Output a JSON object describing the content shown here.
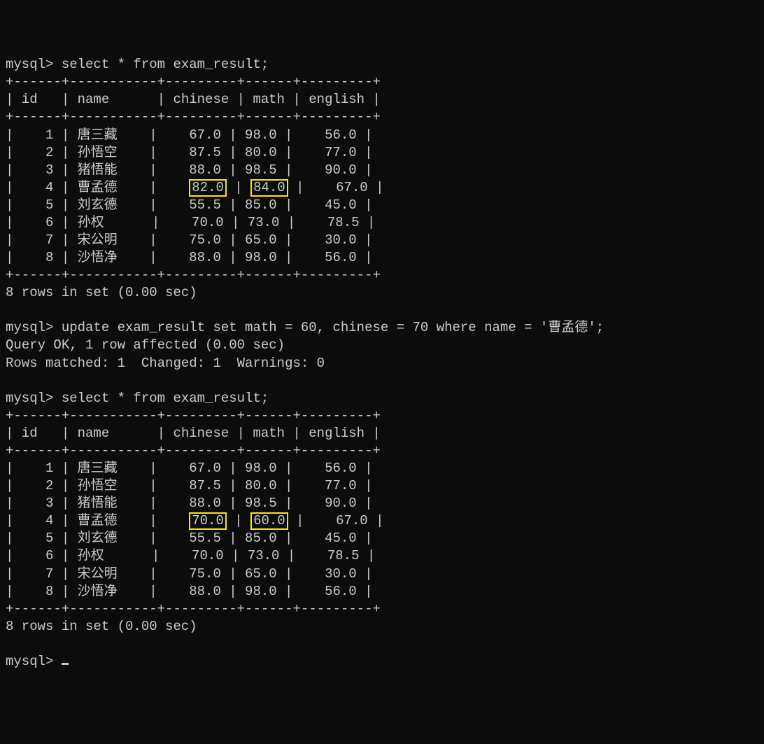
{
  "prompt": "mysql>",
  "query1": "select * from exam_result;",
  "query2": "update exam_result set math = 60, chinese = 70 where name = '曹孟德';",
  "update_result_l1": "Query OK, 1 row affected (0.00 sec)",
  "update_result_l2": "Rows matched: 1  Changed: 1  Warnings: 0",
  "query3": "select * from exam_result;",
  "rows_msg": "8 rows in set (0.00 sec)",
  "border": "+------+-----------+---------+------+---------+",
  "header_line": "| id   | name      | chinese | math | english |",
  "table1": {
    "rows": [
      {
        "id": "1",
        "name": "唐三藏",
        "chinese": "67.0",
        "math": "98.0",
        "english": "56.0",
        "hl": false
      },
      {
        "id": "2",
        "name": "孙悟空",
        "chinese": "87.5",
        "math": "80.0",
        "english": "77.0",
        "hl": false
      },
      {
        "id": "3",
        "name": "猪悟能",
        "chinese": "88.0",
        "math": "98.5",
        "english": "90.0",
        "hl": false
      },
      {
        "id": "4",
        "name": "曹孟德",
        "chinese": "82.0",
        "math": "84.0",
        "english": "67.0",
        "hl": true
      },
      {
        "id": "5",
        "name": "刘玄德",
        "chinese": "55.5",
        "math": "85.0",
        "english": "45.0",
        "hl": false
      },
      {
        "id": "6",
        "name": "孙权",
        "chinese": "70.0",
        "math": "73.0",
        "english": "78.5",
        "hl": false
      },
      {
        "id": "7",
        "name": "宋公明",
        "chinese": "75.0",
        "math": "65.0",
        "english": "30.0",
        "hl": false
      },
      {
        "id": "8",
        "name": "沙悟净",
        "chinese": "88.0",
        "math": "98.0",
        "english": "56.0",
        "hl": false
      }
    ]
  },
  "table2": {
    "rows": [
      {
        "id": "1",
        "name": "唐三藏",
        "chinese": "67.0",
        "math": "98.0",
        "english": "56.0",
        "hl": false
      },
      {
        "id": "2",
        "name": "孙悟空",
        "chinese": "87.5",
        "math": "80.0",
        "english": "77.0",
        "hl": false
      },
      {
        "id": "3",
        "name": "猪悟能",
        "chinese": "88.0",
        "math": "98.5",
        "english": "90.0",
        "hl": false
      },
      {
        "id": "4",
        "name": "曹孟德",
        "chinese": "70.0",
        "math": "60.0",
        "english": "67.0",
        "hl": true
      },
      {
        "id": "5",
        "name": "刘玄德",
        "chinese": "55.5",
        "math": "85.0",
        "english": "45.0",
        "hl": false
      },
      {
        "id": "6",
        "name": "孙权",
        "chinese": "70.0",
        "math": "73.0",
        "english": "78.5",
        "hl": false
      },
      {
        "id": "7",
        "name": "宋公明",
        "chinese": "75.0",
        "math": "65.0",
        "english": "30.0",
        "hl": false
      },
      {
        "id": "8",
        "name": "沙悟净",
        "chinese": "88.0",
        "math": "98.0",
        "english": "56.0",
        "hl": false
      }
    ]
  }
}
